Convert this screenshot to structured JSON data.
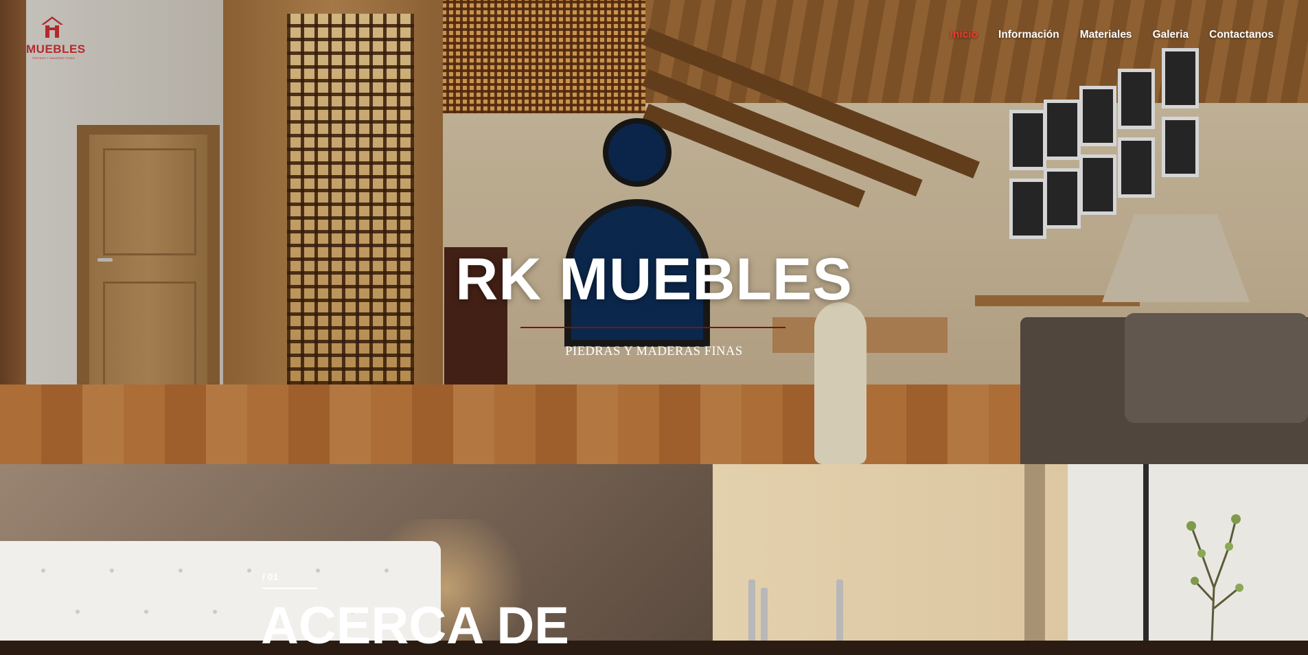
{
  "brand": {
    "logo_text": "MUEBLES",
    "logo_subtext": "PIEDRAS Y MADERAS FINAS",
    "accent_color": "#e63b2c",
    "logo_color": "#b32a2a"
  },
  "nav": {
    "items": [
      {
        "label": "Inicio",
        "active": true
      },
      {
        "label": "Información",
        "active": false
      },
      {
        "label": "Materiales",
        "active": false
      },
      {
        "label": "Galeria",
        "active": false
      },
      {
        "label": "Contactanos",
        "active": false
      }
    ]
  },
  "hero": {
    "title": "RK MUEBLES",
    "subtitle": "PIEDRAS Y MADERAS FINAS"
  },
  "about": {
    "number": "/ 01",
    "title": "ACERCA DE"
  }
}
